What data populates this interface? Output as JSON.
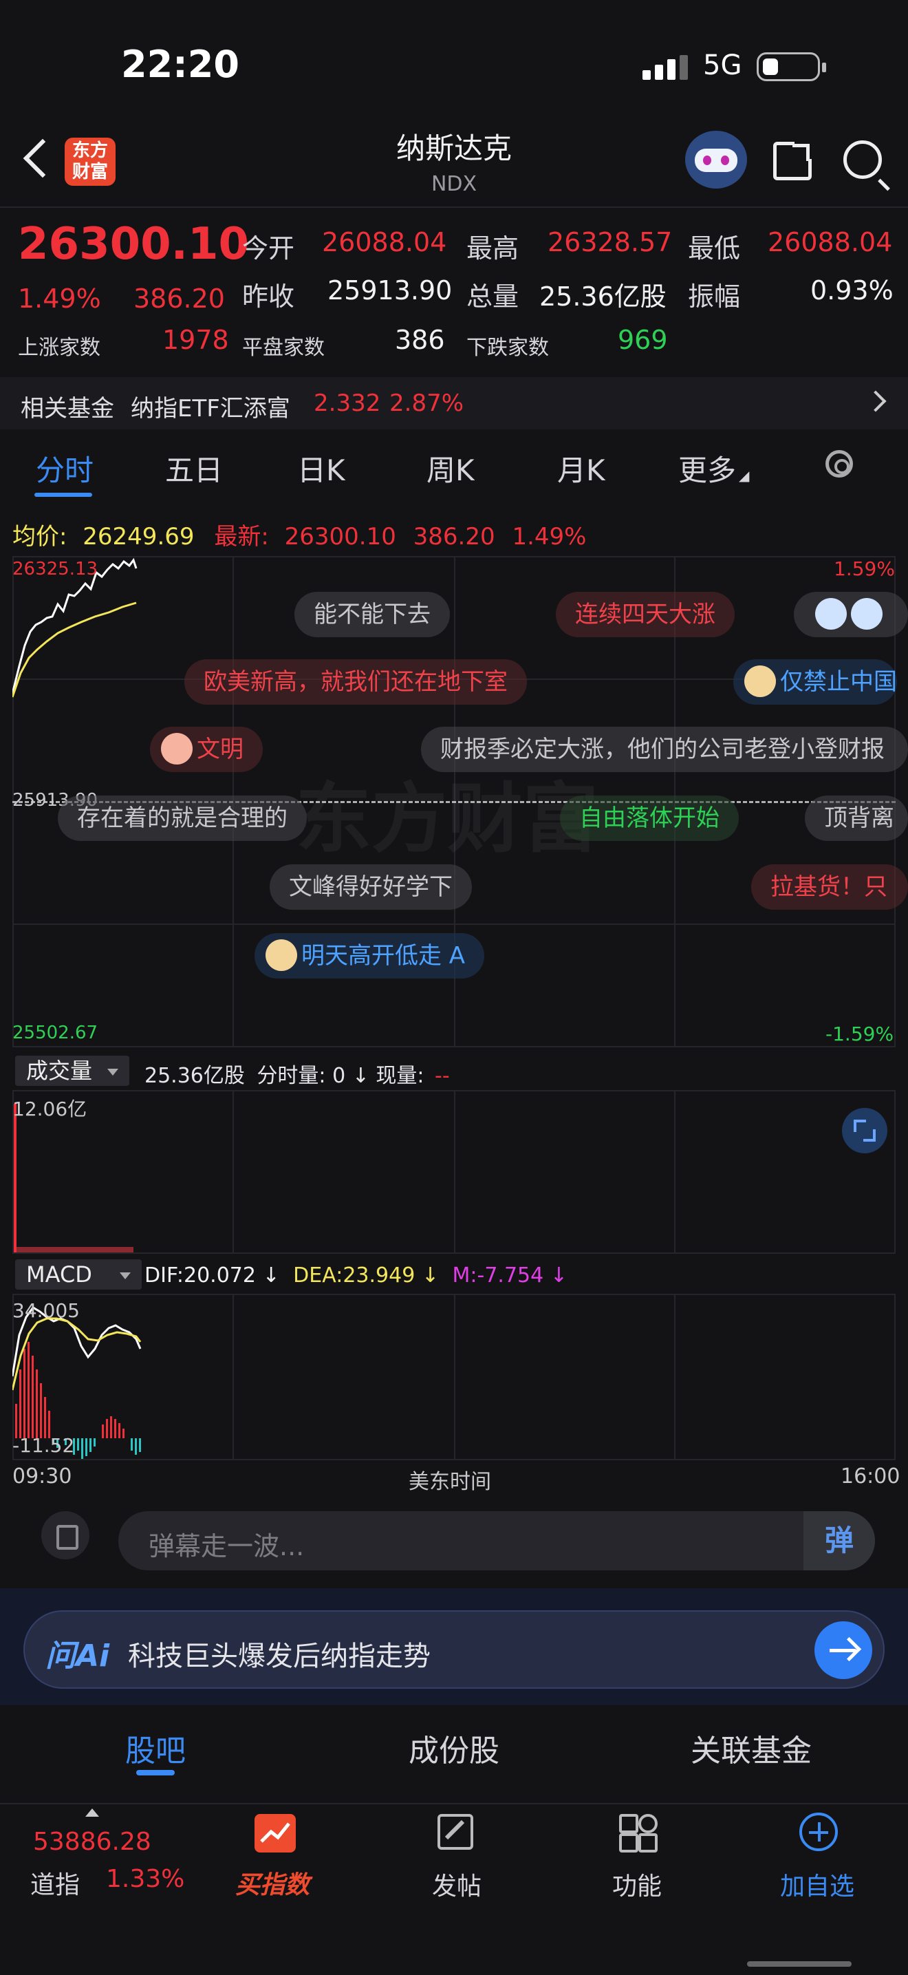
{
  "status": {
    "time": "22:20",
    "network": "5G"
  },
  "header": {
    "title": "纳斯达克",
    "code": "NDX",
    "logo_text": [
      "东方",
      "财富"
    ]
  },
  "quote": {
    "price": "26300.10",
    "change_pct": "1.49%",
    "change": "386.20",
    "open_label": "今开",
    "open": "26088.04",
    "high_label": "最高",
    "high": "26328.57",
    "low_label": "最低",
    "low": "26088.04",
    "prev_close_label": "昨收",
    "prev_close": "25913.90",
    "volume_label": "总量",
    "volume": "25.36亿股",
    "amplitude_label": "振幅",
    "amplitude": "0.93%",
    "up_count_label": "上涨家数",
    "up_count": "1978",
    "flat_count_label": "平盘家数",
    "flat_count": "386",
    "down_count_label": "下跌家数",
    "down_count": "969"
  },
  "related_fund": {
    "label": "相关基金",
    "name": "纳指ETF汇添富",
    "price": "2.332",
    "change_pct": "2.87%"
  },
  "chart_tabs": [
    "分时",
    "五日",
    "日K",
    "周K",
    "月K",
    "更多"
  ],
  "intraday": {
    "avg_label": "均价:",
    "avg": "26249.69",
    "latest_label": "最新:",
    "latest": "26300.10",
    "latest_change": "386.20",
    "latest_pct": "1.49%",
    "y_max": "26325.13",
    "y_mid": "25913.90",
    "y_min": "25502.67",
    "pct_max": "1.59%",
    "pct_min": "-1.59%",
    "watermark": "东方财富"
  },
  "danmaku": [
    "能不能下去",
    "连续四天大涨",
    "欧美新高，就我们还在地下室",
    "仅禁止中国",
    "文明",
    "财报季必定大涨，他们的公司老登小登财报",
    "存在着的就是合理的",
    "自由落体开始",
    "顶背离",
    "文峰得好好学下",
    "拉基货！只",
    "明天高开低走 A"
  ],
  "volume_panel": {
    "selector": "成交量",
    "total": "25.36亿股",
    "minute_label": "分时量: 0",
    "current_label": "现量:",
    "current": "--",
    "y_max": "12.06亿"
  },
  "macd_panel": {
    "selector": "MACD",
    "dif": "DIF:20.072",
    "dea": "DEA:23.949",
    "m": "M:-7.754",
    "y_max": "34.005",
    "y_min": "-11.52"
  },
  "time_axis": {
    "start": "09:30",
    "center": "美东时间",
    "end": "16:00"
  },
  "danmu_input": {
    "placeholder": "弹幕走一波...",
    "button": "弹"
  },
  "ai": {
    "logo": "问Ai",
    "prompt": "科技巨头爆发后纳指走势"
  },
  "sub_tabs": [
    "股吧",
    "成份股",
    "关联基金"
  ],
  "bottom_nav": {
    "dow_value": "53886.28",
    "dow_label": "道指",
    "dow_pct": "1.33%",
    "buy_index": "买指数",
    "post": "发帖",
    "function": "功能",
    "add_watch": "加自选"
  },
  "colors": {
    "up": "#f0313a",
    "down": "#2ed055",
    "accent": "#3b8bf5",
    "avg_line": "#f4e65a"
  }
}
